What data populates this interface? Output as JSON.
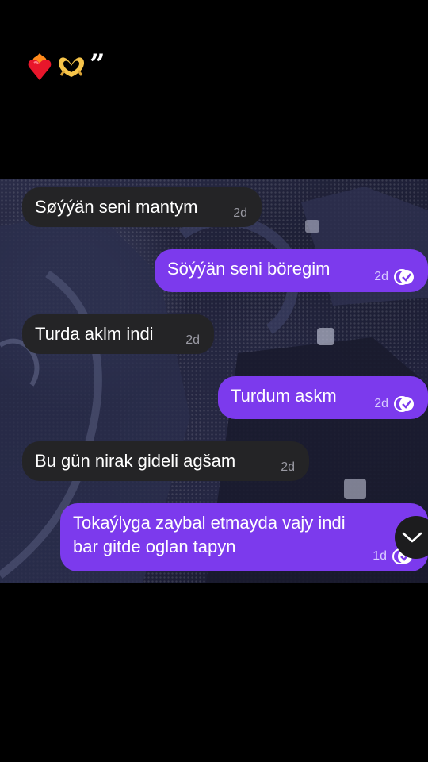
{
  "caption": {
    "emojis": [
      "flaming-heart-icon",
      "heart-hands-icon"
    ],
    "quote": "”"
  },
  "messages": [
    {
      "direction": "incoming",
      "text": "Søýýän seni mantym",
      "time": "2d"
    },
    {
      "direction": "outgoing",
      "text": "Söýýän seni böregim",
      "time": "2d",
      "read": true
    },
    {
      "direction": "incoming",
      "text": "Turda aklm indi",
      "time": "2d"
    },
    {
      "direction": "outgoing",
      "text": "Turdum askm",
      "time": "2d",
      "read": true
    },
    {
      "direction": "incoming",
      "text": "Bu gün nirak gideli agšam",
      "time": "2d"
    },
    {
      "direction": "outgoing",
      "lines": [
        "Tokaýlyga zaybal etmayda vajy indi",
        "bar gitde oglan tapyn"
      ],
      "time": "1d",
      "read": true
    }
  ],
  "colors": {
    "incoming_bubble": "#242426",
    "outgoing_bubble": "#7c3aed",
    "background": "#000000"
  },
  "scroll_button": {
    "icon": "chevron-down-icon"
  }
}
